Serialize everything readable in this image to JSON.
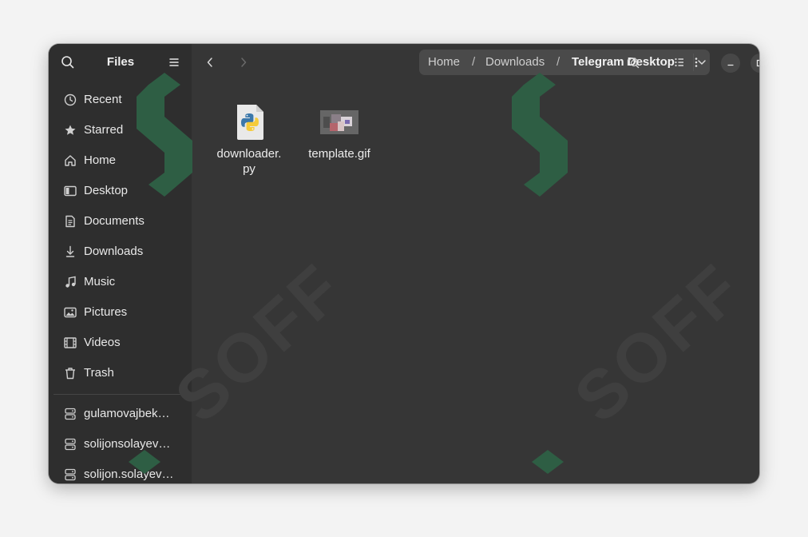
{
  "sidebar": {
    "title": "Files",
    "places": [
      {
        "label": "Recent",
        "icon": "clock-icon"
      },
      {
        "label": "Starred",
        "icon": "star-icon"
      },
      {
        "label": "Home",
        "icon": "home-icon"
      },
      {
        "label": "Desktop",
        "icon": "desktop-icon"
      },
      {
        "label": "Documents",
        "icon": "document-icon"
      },
      {
        "label": "Downloads",
        "icon": "download-icon"
      },
      {
        "label": "Music",
        "icon": "music-icon"
      },
      {
        "label": "Pictures",
        "icon": "picture-icon"
      },
      {
        "label": "Videos",
        "icon": "video-icon"
      },
      {
        "label": "Trash",
        "icon": "trash-icon"
      }
    ],
    "network": [
      {
        "label": "gulamovajbek…",
        "icon": "server-icon"
      },
      {
        "label": "solijonsolayev…",
        "icon": "server-icon"
      },
      {
        "label": "solijon.solayev…",
        "icon": "server-icon"
      }
    ]
  },
  "path": {
    "crumbs": [
      "Home",
      "Downloads",
      "Telegram Desktop"
    ],
    "separator": "/"
  },
  "files": [
    {
      "name_line1": "downloader.",
      "name_line2": "py",
      "icon": "python-file-icon"
    },
    {
      "name_line1": "template.gif",
      "name_line2": "",
      "icon": "gif-thumbnail"
    }
  ],
  "watermark": "SOFF",
  "colors": {
    "window_bg": "#363636",
    "sidebar_bg": "#2e2e2e",
    "watermark_green": "#2e5e44"
  }
}
